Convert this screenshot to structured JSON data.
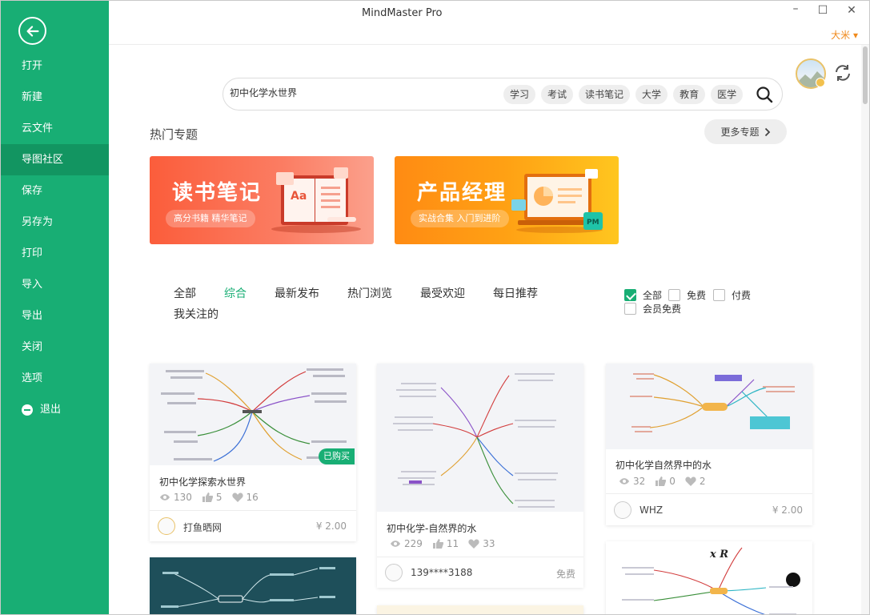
{
  "window": {
    "title": "MindMaster Pro",
    "user": "大米 ▾",
    "min": "–",
    "max": "☐",
    "close": "✕"
  },
  "sidebar": {
    "items": [
      {
        "label": "打开"
      },
      {
        "label": "新建"
      },
      {
        "label": "云文件"
      },
      {
        "label": "导图社区"
      },
      {
        "label": "保存"
      },
      {
        "label": "另存为"
      },
      {
        "label": "打印"
      },
      {
        "label": "导入"
      },
      {
        "label": "导出"
      },
      {
        "label": "关闭"
      },
      {
        "label": "选项"
      },
      {
        "label": "退出"
      }
    ],
    "active_index": 3,
    "colors": {
      "bg": "#18ae74",
      "active": "#129561"
    }
  },
  "search": {
    "value": "初中化学水世界",
    "tags": [
      "学习",
      "考试",
      "读书笔记",
      "大学",
      "教育",
      "医学"
    ],
    "icon": "search-icon"
  },
  "hot": {
    "title": "热门专题",
    "more": "更多专题",
    "banners": [
      {
        "title": "读书笔记",
        "subtitle": "高分书籍 精华笔记"
      },
      {
        "title": "产品经理",
        "subtitle": "实战合集 入门到进阶"
      }
    ]
  },
  "filters": {
    "tabs": [
      "全部",
      "综合",
      "最新发布",
      "热门浏览",
      "最受欢迎",
      "每日推荐",
      "我关注的"
    ],
    "active_tab": "综合",
    "checks": [
      {
        "label": "全部",
        "checked": true
      },
      {
        "label": "免费",
        "checked": false
      },
      {
        "label": "付费",
        "checked": false
      },
      {
        "label": "会员免费",
        "checked": false
      }
    ]
  },
  "cards": [
    {
      "title": "初中化学探索水世界",
      "views": "130",
      "likes": "5",
      "favs": "16",
      "author": "打鱼晒网",
      "price": "¥ 2.00",
      "badge": "已购买"
    },
    {
      "title": "初中化学-自然界的水",
      "views": "229",
      "likes": "11",
      "favs": "33",
      "author": "139****3188",
      "price": "免费"
    },
    {
      "title": "初中化学自然界中的水",
      "views": "32",
      "likes": "0",
      "favs": "2",
      "author": "WHZ",
      "price": "¥ 2.00"
    }
  ],
  "accent": "#18ae74",
  "orange": "#f08a1c"
}
